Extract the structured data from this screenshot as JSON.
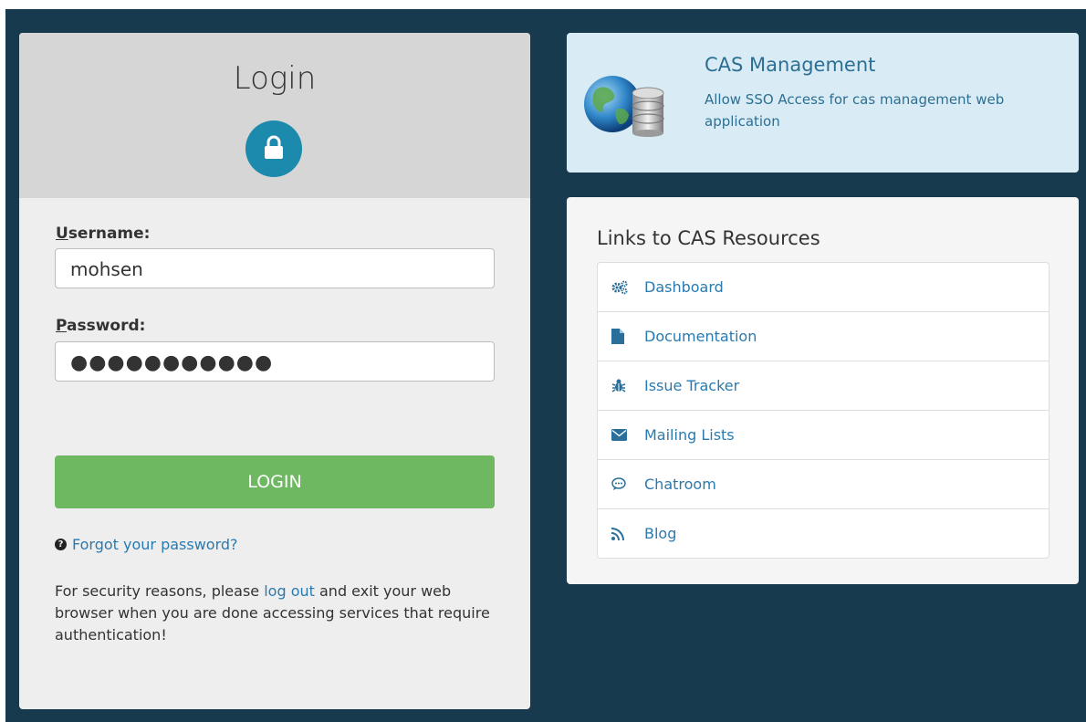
{
  "login": {
    "title": "Login",
    "username_label_first": "U",
    "username_label_rest": "sername:",
    "username_value": "mohsen",
    "password_label_first": "P",
    "password_label_rest": "assword:",
    "password_masked": "●●●●●●●●●●●",
    "button_label": "LOGIN",
    "forgot_link": "Forgot your password?",
    "security_pre": "For security reasons, please ",
    "security_link": "log out",
    "security_post": " and exit your web browser when you are done accessing services that require authentication!"
  },
  "service": {
    "title": "CAS Management",
    "description": "Allow SSO Access for cas management web application"
  },
  "links": {
    "heading": "Links to CAS Resources",
    "items": [
      {
        "label": "Dashboard",
        "icon": "cogs-icon"
      },
      {
        "label": "Documentation",
        "icon": "file-icon"
      },
      {
        "label": "Issue Tracker",
        "icon": "bug-icon"
      },
      {
        "label": "Mailing Lists",
        "icon": "envelope-icon"
      },
      {
        "label": "Chatroom",
        "icon": "comment-icon"
      },
      {
        "label": "Blog",
        "icon": "rss-icon"
      }
    ]
  },
  "colors": {
    "background": "#173a4f",
    "accent": "#1b8aac",
    "login_button": "#6fb862",
    "link": "#2a7ab0"
  }
}
